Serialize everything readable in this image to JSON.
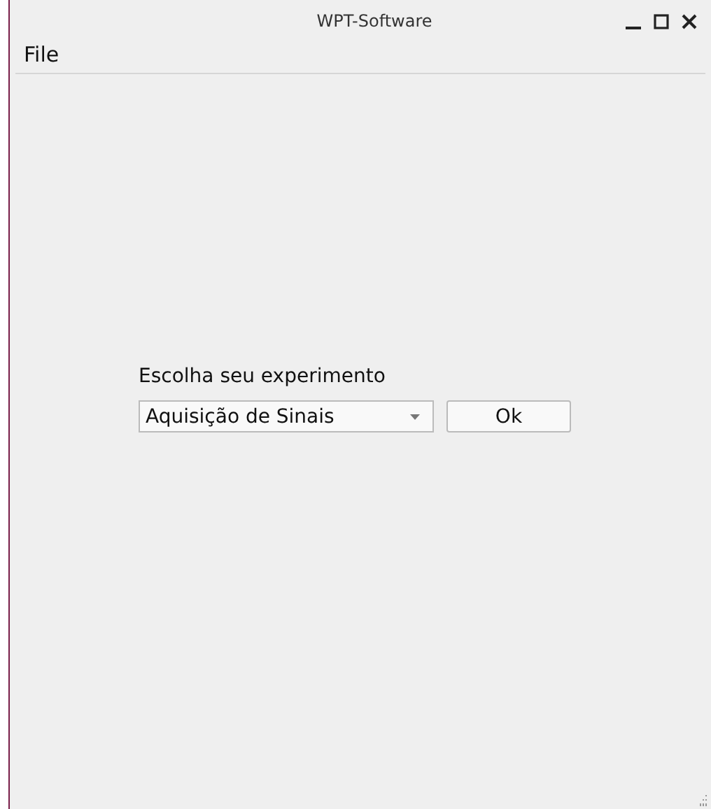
{
  "window": {
    "title": "WPT-Software"
  },
  "menu": [
    {
      "label": "File"
    }
  ],
  "prompt": "Escolha seu experimento",
  "combo": {
    "value": "Aquisição de Sinais"
  },
  "buttons": [
    "Ok"
  ]
}
